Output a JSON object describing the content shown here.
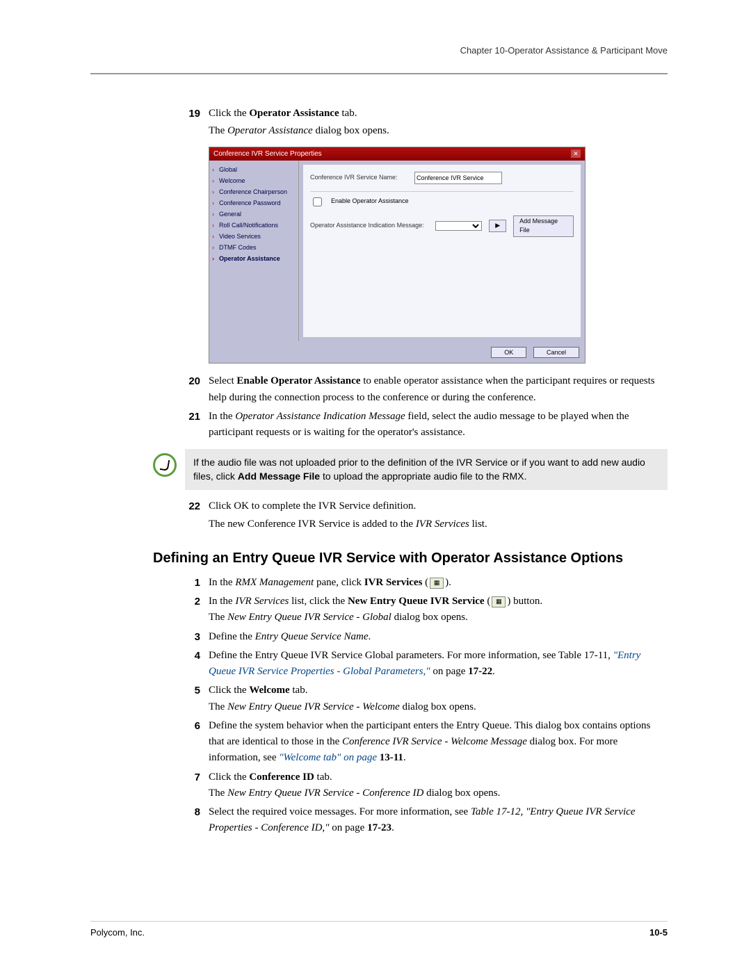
{
  "chapter_ref": "Chapter 10-Operator Assistance & Participant Move",
  "steps_a": [
    {
      "n": "19",
      "lines": [
        "Click the <b>Operator Assistance</b> tab.",
        "The <i>Operator Assistance</i> dialog box opens."
      ]
    },
    {
      "n": "20",
      "lines": [
        "Select <b>Enable Operator Assistance</b> to enable operator assistance when the participant requires or requests help during the connection process to the conference or during the conference."
      ]
    },
    {
      "n": "21",
      "lines": [
        "In the <i>Operator Assistance Indication Message</i> field, select the audio message to be played when the participant requests or is waiting for the operator's assistance."
      ]
    }
  ],
  "dialog": {
    "title": "Conference IVR Service Properties",
    "side_items": [
      "Global",
      "Welcome",
      "Conference Chairperson",
      "Conference Password",
      "General",
      "Roll Call/Notifications",
      "Video Services",
      "DTMF Codes",
      "Operator Assistance"
    ],
    "active_side": "Operator Assistance",
    "service_name_label": "Conference IVR Service Name:",
    "service_name_value": "Conference IVR Service",
    "enable_label": "Enable Operator Assistance",
    "indication_label": "Operator Assistance Indication Message:",
    "add_btn": "Add Message File",
    "ok": "OK",
    "cancel": "Cancel"
  },
  "note": "If the audio file was not uploaded prior to the definition of the IVR Service or if you want to add new audio files, click <b>Add Message File</b> to upload the appropriate audio file to the RMX.",
  "step22": {
    "n": "22",
    "lines": [
      "Click OK to complete the IVR Service definition.",
      "The new Conference IVR Service is added to the <i>IVR Services</i> list."
    ]
  },
  "section_heading": "Defining an Entry Queue IVR Service with Operator Assistance Options",
  "steps_b": [
    {
      "n": "1",
      "html": "In the <i>RMX Management</i> pane, click <b>IVR Services</b> (<span class='inline-icon'>▦</span>)."
    },
    {
      "n": "2",
      "html": "In the <i>IVR Services</i> list, click the <b>New Entry Queue IVR Service</b> (<span class='inline-icon'>▦</span>) button.<br>The <i>New Entry Queue IVR Service - Global</i> dialog box opens."
    },
    {
      "n": "3",
      "html": "Define the <i>Entry Queue Service Name</i>."
    },
    {
      "n": "4",
      "html": "Define the Entry Queue IVR Service Global parameters. For more information, see Table 17-11, <span class='link'><i>\"Entry Queue IVR Service Properties - Global Parameters,\"</i></span> on page <b>17-22</b>."
    },
    {
      "n": "5",
      "html": "Click the <b>Welcome</b> tab.<br>The <i>New Entry Queue IVR Service - Welcome</i> dialog box opens."
    },
    {
      "n": "6",
      "html": "Define the system behavior when the participant enters the Entry Queue. This dialog box contains options that are identical to those in the <i>Conference IVR Service - Welcome Message</i> dialog box. For more information, see <span class='link'><i>\"Welcome tab\" on page </i></span><b>13-11</b>."
    },
    {
      "n": "7",
      "html": "Click the <b>Conference ID</b> tab.<br>The <i>New Entry Queue IVR Service - Conference ID</i> dialog box opens."
    },
    {
      "n": "8",
      "html": "Select the required voice messages. For more information, see <i>Table 17-12, \"Entry Queue IVR Service Properties - Conference ID,\"</i> on page <b>17-23</b>."
    }
  ],
  "footer_left": "Polycom, Inc.",
  "footer_right": "10-5"
}
